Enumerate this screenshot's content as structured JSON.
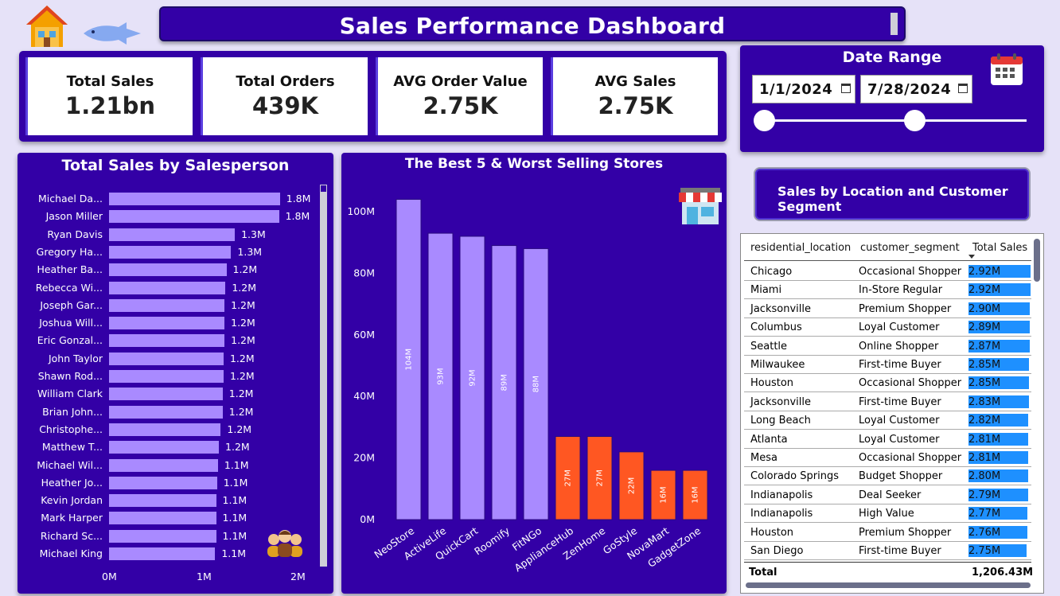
{
  "header": {
    "title": "Sales Performance Dashboard",
    "home_icon": "home-icon",
    "back_icon": "back-arrow-icon"
  },
  "kpis": [
    {
      "label": "Total Sales",
      "value": "1.21bn"
    },
    {
      "label": "Total Orders",
      "value": "439K"
    },
    {
      "label": "AVG Order Value",
      "value": "2.75K"
    },
    {
      "label": "AVG Sales",
      "value": "2.75K"
    }
  ],
  "date_range": {
    "title": "Date Range",
    "start": "1/1/2024",
    "end": "7/28/2024",
    "icon": "calendar-icon"
  },
  "location_button": {
    "label": "Sales by Location and Customer Segment"
  },
  "salesperson_chart": {
    "title": "Total Sales by Salesperson",
    "icon": "team-icon"
  },
  "stores_chart": {
    "title": "The Best 5 & Worst Selling Stores",
    "icon": "store-icon"
  },
  "table": {
    "columns": [
      "residential_location",
      "customer_segment",
      "Total Sales"
    ],
    "rows": [
      [
        "Chicago",
        "Occasional Shopper",
        "2.92M"
      ],
      [
        "Miami",
        "In-Store Regular",
        "2.92M"
      ],
      [
        "Jacksonville",
        "Premium Shopper",
        "2.90M"
      ],
      [
        "Columbus",
        "Loyal Customer",
        "2.89M"
      ],
      [
        "Seattle",
        "Online Shopper",
        "2.87M"
      ],
      [
        "Milwaukee",
        "First-time Buyer",
        "2.85M"
      ],
      [
        "Houston",
        "Occasional Shopper",
        "2.85M"
      ],
      [
        "Jacksonville",
        "First-time Buyer",
        "2.83M"
      ],
      [
        "Long Beach",
        "Loyal Customer",
        "2.82M"
      ],
      [
        "Atlanta",
        "Loyal Customer",
        "2.81M"
      ],
      [
        "Mesa",
        "Occasional Shopper",
        "2.81M"
      ],
      [
        "Colorado Springs",
        "Budget Shopper",
        "2.80M"
      ],
      [
        "Indianapolis",
        "Deal Seeker",
        "2.79M"
      ],
      [
        "Indianapolis",
        "High Value",
        "2.77M"
      ],
      [
        "Houston",
        "Premium Shopper",
        "2.76M"
      ],
      [
        "San Diego",
        "First-time Buyer",
        "2.75M"
      ]
    ],
    "values": [
      2.92,
      2.92,
      2.9,
      2.89,
      2.87,
      2.85,
      2.85,
      2.83,
      2.82,
      2.81,
      2.81,
      2.8,
      2.79,
      2.77,
      2.76,
      2.75
    ],
    "total_label": "Total",
    "total_value": "1,206.43M"
  },
  "colors": {
    "panel": "#3300a6",
    "bar": "#a98aff",
    "worst": "#ff5722",
    "accent": "#1e90ff"
  },
  "chart_data": [
    {
      "type": "bar",
      "title": "Total Sales by Salesperson",
      "orientation": "horizontal",
      "categories": [
        "Michael Da...",
        "Jason Miller",
        "Ryan Davis",
        "Gregory Ha...",
        "Heather Ba...",
        "Rebecca Wi...",
        "Joseph Gar...",
        "Joshua Will...",
        "Eric Gonzal...",
        "John Taylor",
        "Shawn Rod...",
        "William Clark",
        "Brian John...",
        "Christophe...",
        "Matthew T...",
        "Michael Wil...",
        "Heather Jo...",
        "Kevin Jordan",
        "Mark Harper",
        "Richard Sc...",
        "Michael King"
      ],
      "values": [
        1.82,
        1.81,
        1.34,
        1.3,
        1.25,
        1.24,
        1.23,
        1.23,
        1.23,
        1.22,
        1.22,
        1.21,
        1.21,
        1.19,
        1.17,
        1.16,
        1.15,
        1.14,
        1.14,
        1.14,
        1.13
      ],
      "labels": [
        "1.8M",
        "1.8M",
        "1.3M",
        "1.3M",
        "1.2M",
        "1.2M",
        "1.2M",
        "1.2M",
        "1.2M",
        "1.2M",
        "1.2M",
        "1.2M",
        "1.2M",
        "1.2M",
        "1.2M",
        "1.1M",
        "1.1M",
        "1.1M",
        "1.1M",
        "1.1M",
        "1.1M"
      ],
      "xlim": [
        0,
        2
      ],
      "xticks": [
        "0M",
        "1M",
        "2M"
      ]
    },
    {
      "type": "bar",
      "title": "The Best 5 & Worst Selling Stores",
      "categories": [
        "NeoStore",
        "ActiveLife",
        "QuickCart",
        "Roomify",
        "FitNGo",
        "ApplianceHub",
        "ZenHome",
        "GoStyle",
        "NovaMart",
        "GadgetZone"
      ],
      "values": [
        104,
        93,
        92,
        89,
        88,
        27,
        27,
        22,
        16,
        16
      ],
      "labels": [
        "104M",
        "93M",
        "92M",
        "89M",
        "88M",
        "27M",
        "27M",
        "22M",
        "16M",
        "16M"
      ],
      "group": [
        "best",
        "best",
        "best",
        "best",
        "best",
        "worst",
        "worst",
        "worst",
        "worst",
        "worst"
      ],
      "ylim": [
        0,
        110
      ],
      "yticks": [
        "0M",
        "20M",
        "40M",
        "60M",
        "80M",
        "100M"
      ]
    }
  ]
}
